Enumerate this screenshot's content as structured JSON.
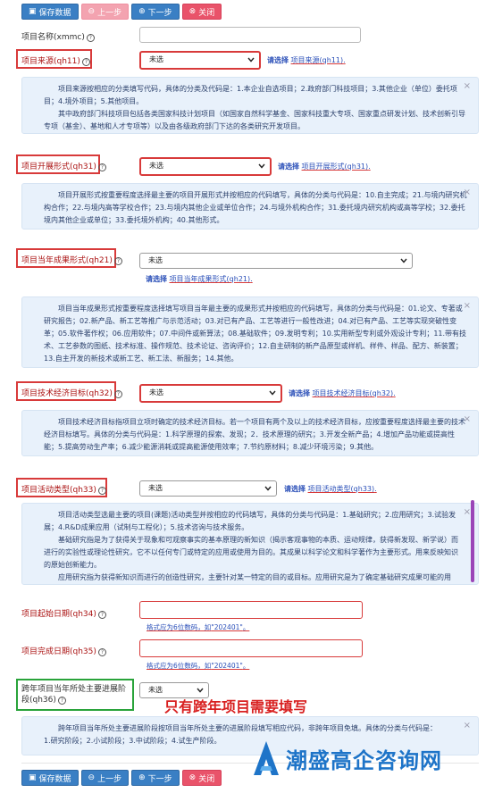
{
  "toolbar": {
    "save": "保存数据",
    "prev": "上一步",
    "next": "下一步",
    "close": "关闭"
  },
  "fields": {
    "xmmc": {
      "label": "项目名称(xmmc)"
    },
    "qh11": {
      "label": "项目来源(qh11)",
      "value": "未选",
      "hint_prefix": "请选择",
      "hint_field": "项目来源(qh11)",
      "help": [
        "项目来源按相应的分类填写代码，具体的分类及代码是：1.本企业自选项目；2.政府部门科技项目；3.其他企业（单位）委托项目；4.境外项目；5.其他项目。",
        "其中政府部门科技项目包括各类国家科技计划项目（如国家自然科学基金、国家科技重大专项、国家重点研发计划、技术创新引导专项（基金）、基地和人才专项等）以及由各级政府部门下达的各类研究开发项目。"
      ]
    },
    "qh31": {
      "label": "项目开展形式(qh31)",
      "value": "未选",
      "hint_prefix": "请选择",
      "hint_field": "项目开展形式(qh31)",
      "help": [
        "项目开展形式按重要程度选择最主要的项目开展形式并按相应的代码填写，具体的分类与代码是：10.自主完成；21.与境内研究机构合作；22.与境内高等学校合作；23.与境内其他企业或单位合作；24.与境外机构合作；31.委托境内研究机构或高等学校；32.委托境内其他企业或单位；33.委托境外机构；40.其他形式。"
      ]
    },
    "qh21": {
      "label": "项目当年成果形式(qh21)",
      "value": "未选",
      "hint_prefix": "请选择",
      "hint_field": "项目当年成果形式(qh21)",
      "help": [
        "项目当年成果形式按重要程度选择填写项目当年最主要的成果形式并按相应的代码填写，具体的分类与代码是：01.论文、专著或研究报告；02.新产品、新工艺等推广与示范活动；03.对已有产品、工艺等进行一般性改进；04.对已有产品、工艺等实现突破性变革；05.软件著作权；06.应用软件；07.中间件或新算法；08.基础软件；09.发明专利；10.实用新型专利或外观设计专利；11.带有技术、工艺参数的图纸、技术标准、操作规范、技术论证、咨询评价；12.自主研制的新产品原型或样机、样件、样品、配方、新装置；13.自主开发的新技术或新工艺、新工法、新服务；14.其他。"
      ]
    },
    "qh32": {
      "label": "项目技术经济目标(qh32)",
      "value": "未选",
      "hint_prefix": "请选择",
      "hint_field": "项目技术经济目标(qh32)",
      "help": [
        "项目技术经济目标指项目立项时确定的技术经济目标。若一个项目有两个及以上的技术经济目标，应按重要程度选择最主要的技术经济目标填写。具体的分类与代码是：1.科学原理的探索、发现；2．技术原理的研究；3.开发全新产品；4.增加产品功能或提高性能；5.提高劳动生产率；6.减少能源消耗或提高能源使用效率；7.节约原材料；8.减少环境污染；9.其他。"
      ]
    },
    "qh33": {
      "label": "项目活动类型(qh33)",
      "value": "未选",
      "hint_prefix": "请选择",
      "hint_field": "项目活动类型(qh33)",
      "help": [
        "项目活动类型选最主要的项目(课题)活动类型并按相应的代码填写，具体的分类与代码是：1.基础研究；2.应用研究；3.试验发展；4.R&D成果应用（试制与工程化）；5.技术咨询与技术服务。",
        "基础研究指是为了获得关于现象和可观察事实的基本原理的新知识（揭示客观事物的本质、运动规律，获得新发现、新学说）而进行的实验性或理论性研究，它不以任何专门或特定的应用或使用为目的。其成果以科学论文和科学著作为主要形式。用来反映知识的原始创新能力。",
        "应用研究指为获得新知识而进行的创造性研究，主要针对某一特定的目的或目标。应用研究是为了确定基础研究成果可能的用"
      ]
    },
    "qh34": {
      "label": "项目起始日期(qh34)",
      "warn_prefix": "格式应为6位数码，如",
      "warn_example": "\"202401\"",
      "warn_suffix": "。"
    },
    "qh35": {
      "label": "项目完成日期(qh35)",
      "warn_prefix": "格式应为6位数码，如",
      "warn_example": "\"202401\"",
      "warn_suffix": "。"
    },
    "qh36": {
      "label_line1": "跨年项目当年所处主要进展阶",
      "label_line2": "段(qh36)",
      "value": "未选",
      "annotation": "只有跨年项目需要填写",
      "help": [
        "跨年项目当年所处主要进展阶段按项目当年所处主要的进展阶段填写相应代码，非跨年项目免填。具体的分类与代码是：",
        "1.研究阶段；2.小试阶段；3.中试阶段；4.试生产阶段。"
      ]
    }
  },
  "watermark": {
    "text": "潮盛高企咨询网"
  },
  "colors": {
    "primary": "#3a7fc4",
    "danger": "#e9536a",
    "highlight_red": "#d83a3a",
    "highlight_green": "#29a33a",
    "help_bg": "#e8f1fb",
    "hint_text": "#2a4fb8"
  }
}
